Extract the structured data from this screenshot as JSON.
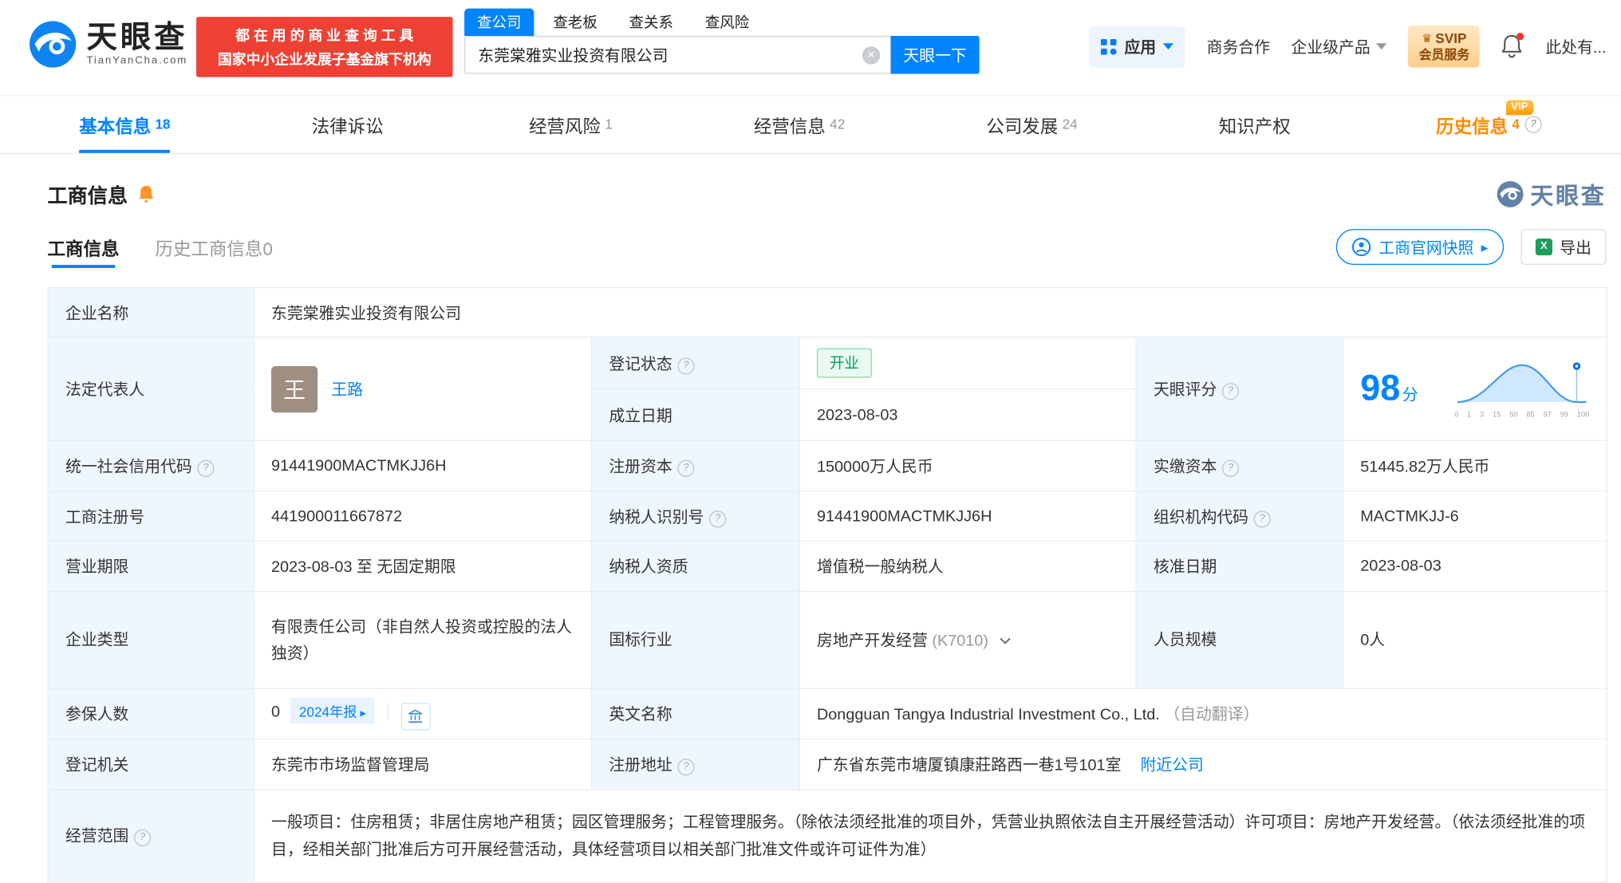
{
  "brand": {
    "name": "天眼查",
    "domain": "TianYanCha.com"
  },
  "promo": {
    "line1": "都 在 用 的 商 业 查 询 工 具",
    "line2": "国家中小企业发展子基金旗下机构"
  },
  "search": {
    "tabs": [
      {
        "label": "查公司"
      },
      {
        "label": "查老板"
      },
      {
        "label": "查关系"
      },
      {
        "label": "查风险"
      }
    ],
    "value": "东莞棠雅实业投资有限公司",
    "submit": "天眼一下"
  },
  "topnav": {
    "apps": "应用",
    "cooperation": "商务合作",
    "enterprise": "企业级产品",
    "svip_top": "SVIP",
    "svip_bottom": "会员服务",
    "more": "此处有..."
  },
  "tabs": [
    {
      "label": "基本信息",
      "count": "18"
    },
    {
      "label": "法律诉讼",
      "count": ""
    },
    {
      "label": "经营风险",
      "count": "1"
    },
    {
      "label": "经营信息",
      "count": "42"
    },
    {
      "label": "公司发展",
      "count": "24"
    },
    {
      "label": "知识产权",
      "count": ""
    },
    {
      "label": "历史信息",
      "count": "4",
      "vip": "VIP"
    }
  ],
  "section": {
    "title": "工商信息",
    "watermark": "天眼查"
  },
  "subtabs": {
    "current": "工商信息",
    "history": "历史工商信息0"
  },
  "toolbar": {
    "snapshot": "工商官网快照",
    "export": "导出"
  },
  "info": {
    "company_name": {
      "label": "企业名称",
      "value": "东莞棠雅实业投资有限公司"
    },
    "legal_rep": {
      "label": "法定代表人",
      "avatar": "王",
      "name": "王路"
    },
    "reg_status": {
      "label": "登记状态",
      "value": "开业"
    },
    "establish_date": {
      "label": "成立日期",
      "value": "2023-08-03"
    },
    "score": {
      "label": "天眼评分",
      "value": "98",
      "unit": "分",
      "ticks": [
        "0",
        "1",
        "3",
        "15",
        "50",
        "85",
        "97",
        "99",
        "100"
      ]
    },
    "credit_code": {
      "label": "统一社会信用代码",
      "value": "91441900MACTMKJJ6H"
    },
    "reg_capital": {
      "label": "注册资本",
      "value": "150000万人民币"
    },
    "paid_capital": {
      "label": "实缴资本",
      "value": "51445.82万人民币"
    },
    "reg_number": {
      "label": "工商注册号",
      "value": "441900011667872"
    },
    "taxpayer_id": {
      "label": "纳税人识别号",
      "value": "91441900MACTMKJJ6H"
    },
    "org_code": {
      "label": "组织机构代码",
      "value": "MACTMKJJ-6"
    },
    "business_term": {
      "label": "营业期限",
      "value": "2023-08-03 至 无固定期限"
    },
    "taxpayer_quality": {
      "label": "纳税人资质",
      "value": "增值税一般纳税人"
    },
    "approval_date": {
      "label": "核准日期",
      "value": "2023-08-03"
    },
    "company_type": {
      "label": "企业类型",
      "value": "有限责任公司（非自然人投资或控股的法人独资）"
    },
    "industry": {
      "label": "国标行业",
      "value": "房地产开发经营",
      "code": "(K7010)"
    },
    "staff_size": {
      "label": "人员规模",
      "value": "0人"
    },
    "insured_count": {
      "label": "参保人数",
      "value": "0",
      "report": "2024年报"
    },
    "english_name": {
      "label": "英文名称",
      "value": "Dongguan Tangya Industrial Investment Co., Ltd.",
      "note": "（自动翻译）"
    },
    "reg_authority": {
      "label": "登记机关",
      "value": "东莞市市场监督管理局"
    },
    "reg_address": {
      "label": "注册地址",
      "value": "广东省东莞市塘厦镇康莊路西一巷1号101室",
      "link": "附近公司"
    },
    "business_scope": {
      "label": "经营范围",
      "value": "一般项目：住房租赁；非居住房地产租赁；园区管理服务；工程管理服务。（除依法须经批准的项目外，凭营业执照依法自主开展经营活动）许可项目：房地产开发经营。（依法须经批准的项目，经相关部门批准后方可开展经营活动，具体经营项目以相关部门批准文件或许可证件为准）"
    }
  },
  "colors": {
    "accent": "#0084ff",
    "vip_orange": "#ff8a00",
    "status_green": "#00a35a",
    "promo_red": "#ef4034"
  }
}
